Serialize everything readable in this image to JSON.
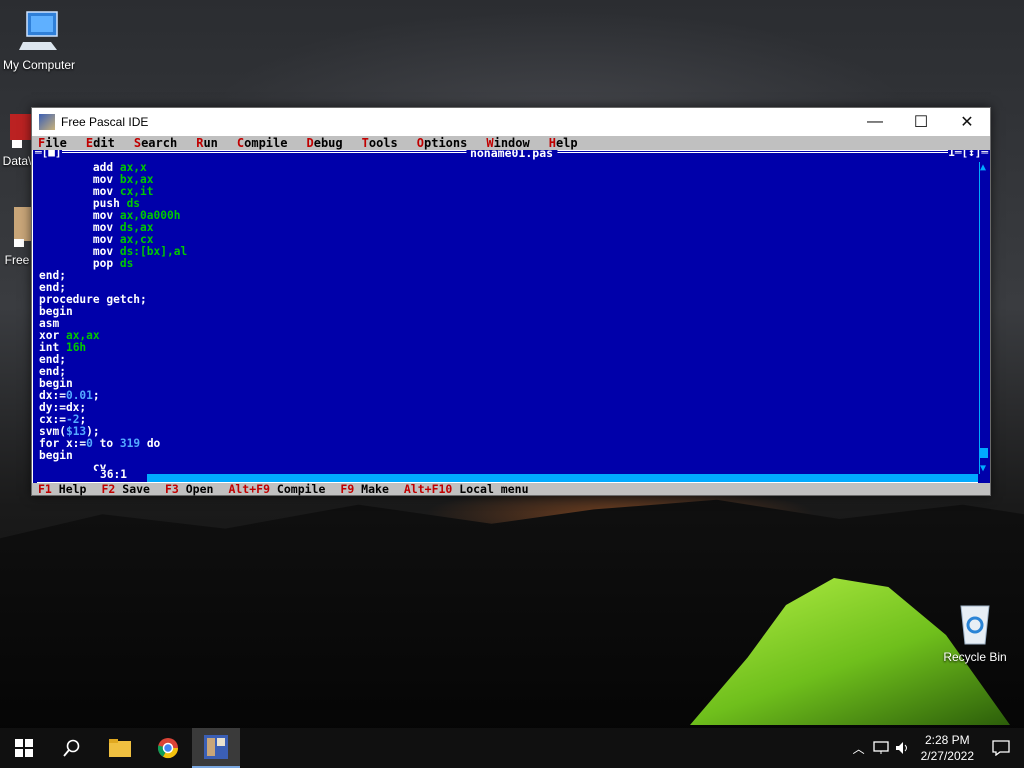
{
  "desktop": {
    "icons": [
      {
        "label": "My Computer"
      },
      {
        "label": "Data\\"
      },
      {
        "label": "Free"
      },
      {
        "label": "Recycle Bin"
      }
    ]
  },
  "window": {
    "title": "Free Pascal IDE",
    "minimize_glyph": "—",
    "maximize_glyph": "☐",
    "close_glyph": "✕"
  },
  "menu": [
    {
      "hot": "F",
      "rest": "ile"
    },
    {
      "hot": "E",
      "rest": "dit"
    },
    {
      "hot": "S",
      "rest": "earch"
    },
    {
      "hot": "R",
      "rest": "un"
    },
    {
      "hot": "C",
      "rest": "ompile"
    },
    {
      "hot": "D",
      "rest": "ebug"
    },
    {
      "hot": "T",
      "rest": "ools"
    },
    {
      "hot": "O",
      "rest": "ptions"
    },
    {
      "hot": "W",
      "rest": "indow"
    },
    {
      "hot": "H",
      "rest": "elp"
    }
  ],
  "editor": {
    "filename": "noname01.pas",
    "left_bracket": "═[■]",
    "right_bracket": "1═[↕]═",
    "cursor_pos": "36:1",
    "status_left": "═══*═══"
  },
  "code_lines": [
    [
      {
        "t": "        add ",
        "c": "kw"
      },
      {
        "t": "ax,x",
        "c": "arg"
      }
    ],
    [
      {
        "t": "        mov ",
        "c": "kw"
      },
      {
        "t": "bx,ax",
        "c": "arg"
      }
    ],
    [
      {
        "t": "        mov ",
        "c": "kw"
      },
      {
        "t": "cx,it",
        "c": "arg"
      }
    ],
    [
      {
        "t": "        push ",
        "c": "kw"
      },
      {
        "t": "ds",
        "c": "arg"
      }
    ],
    [
      {
        "t": "        mov ",
        "c": "kw"
      },
      {
        "t": "ax,0a000h",
        "c": "arg"
      }
    ],
    [
      {
        "t": "        mov ",
        "c": "kw"
      },
      {
        "t": "ds,ax",
        "c": "arg"
      }
    ],
    [
      {
        "t": "        mov ",
        "c": "kw"
      },
      {
        "t": "ax,cx",
        "c": "arg"
      }
    ],
    [
      {
        "t": "        mov ",
        "c": "kw"
      },
      {
        "t": "ds:[bx],al",
        "c": "arg"
      }
    ],
    [
      {
        "t": "        pop ",
        "c": "kw"
      },
      {
        "t": "ds",
        "c": "arg"
      }
    ],
    [
      {
        "t": "end;",
        "c": "kw"
      }
    ],
    [
      {
        "t": "end;",
        "c": "kw"
      }
    ],
    [
      {
        "t": "procedure getch;",
        "c": "kw"
      }
    ],
    [
      {
        "t": "begin",
        "c": "kw"
      }
    ],
    [
      {
        "t": "asm",
        "c": "kw"
      }
    ],
    [
      {
        "t": "xor ",
        "c": "kw"
      },
      {
        "t": "ax,ax",
        "c": "arg"
      }
    ],
    [
      {
        "t": "int ",
        "c": "kw"
      },
      {
        "t": "16h",
        "c": "arg"
      }
    ],
    [
      {
        "t": "end;",
        "c": "kw"
      }
    ],
    [
      {
        "t": "end;",
        "c": "kw"
      }
    ],
    [
      {
        "t": "begin",
        "c": "kw"
      }
    ],
    [
      {
        "t": "dx:=",
        "c": "kw"
      },
      {
        "t": "0.01",
        "c": "num"
      },
      {
        "t": ";",
        "c": "kw"
      }
    ],
    [
      {
        "t": "dy:=dx;",
        "c": "kw"
      }
    ],
    [
      {
        "t": "cx:=",
        "c": "kw"
      },
      {
        "t": "-2",
        "c": "num"
      },
      {
        "t": ";",
        "c": "kw"
      }
    ],
    [
      {
        "t": "svm(",
        "c": "kw"
      },
      {
        "t": "$13",
        "c": "num"
      },
      {
        "t": ");",
        "c": "kw"
      }
    ],
    [
      {
        "t": "for x:=",
        "c": "kw"
      },
      {
        "t": "0",
        "c": "num"
      },
      {
        "t": " to ",
        "c": "kw"
      },
      {
        "t": "319",
        "c": "num"
      },
      {
        "t": " do",
        "c": "kw"
      }
    ],
    [
      {
        "t": "begin",
        "c": "kw"
      }
    ],
    [
      {
        "t": "        cy",
        "c": "kw"
      }
    ]
  ],
  "fkeys": [
    {
      "key": "F1",
      "label": " Help"
    },
    {
      "key": "F2",
      "label": " Save"
    },
    {
      "key": "F3",
      "label": " Open"
    },
    {
      "key": "Alt+F9",
      "label": " Compile"
    },
    {
      "key": "F9",
      "label": " Make"
    },
    {
      "key": "Alt+F10",
      "label": " Local menu"
    }
  ],
  "taskbar": {
    "time": "2:28 PM",
    "date": "2/27/2022"
  },
  "colors": {
    "editor_bg": "#0000aa",
    "keyword": "#ffffff",
    "asm_operand": "#00c800",
    "number": "#55aaff",
    "menu_hotkey": "#c00000"
  }
}
